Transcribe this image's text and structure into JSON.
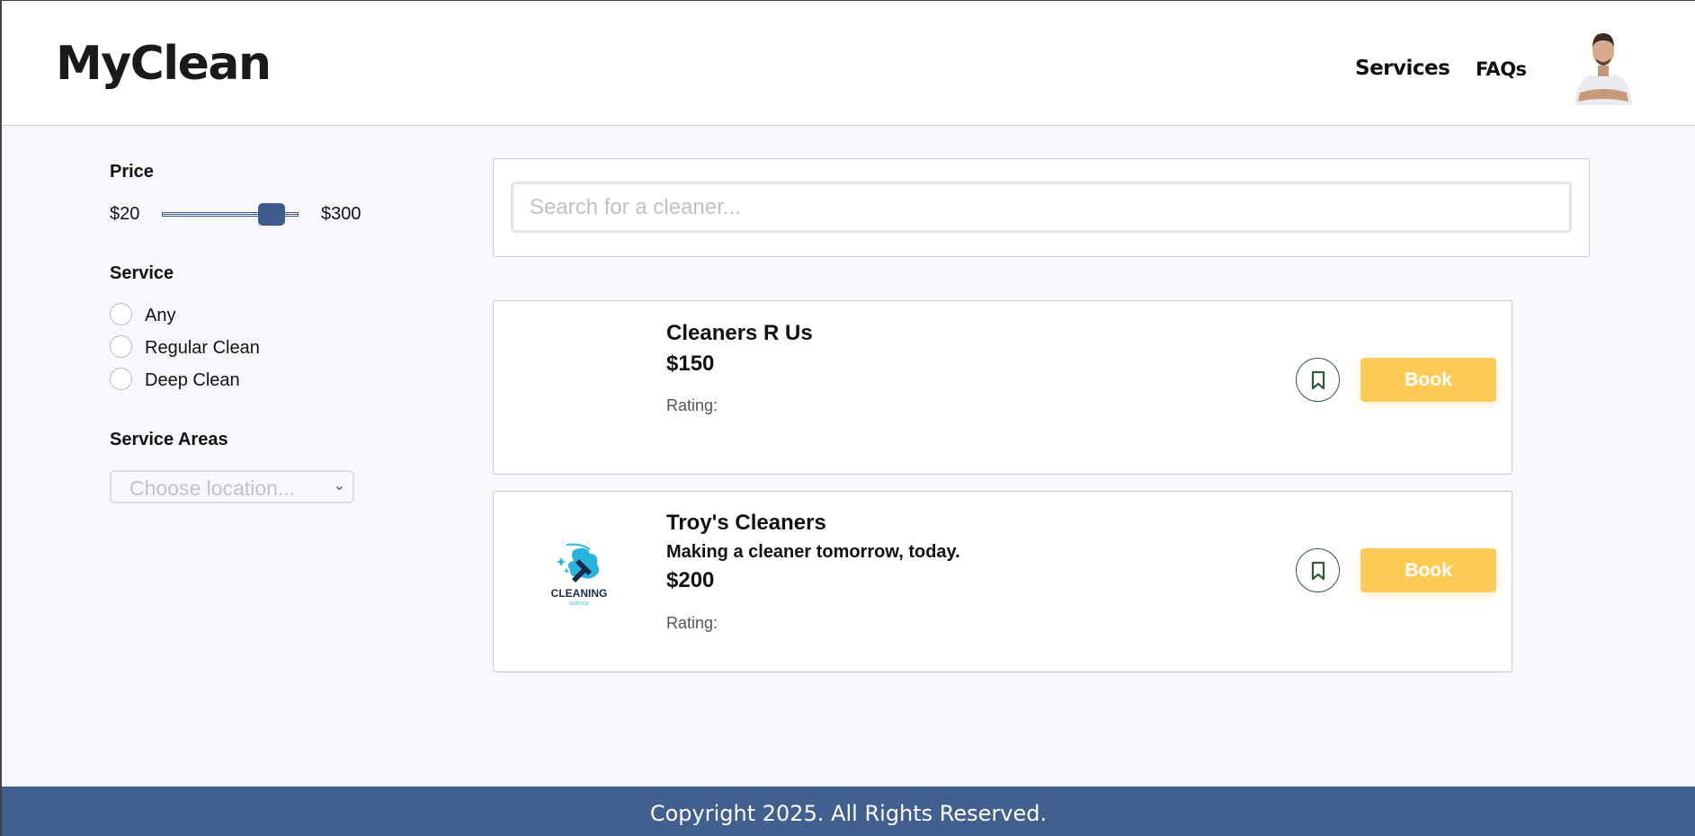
{
  "brand": {
    "name": "MyClean"
  },
  "nav": {
    "services": "Services",
    "faqs": "FAQs"
  },
  "filters": {
    "price": {
      "label": "Price",
      "min_label": "$20",
      "max_label": "$300",
      "min": 20,
      "max": 300,
      "value_fraction": 0.75
    },
    "service": {
      "label": "Service",
      "options": [
        "Any",
        "Regular Clean",
        "Deep Clean"
      ]
    },
    "areas": {
      "label": "Service Areas",
      "placeholder": "Choose location..."
    }
  },
  "search": {
    "placeholder": "Search for a cleaner..."
  },
  "cleaners": [
    {
      "name": "Cleaners R Us",
      "price": "$150",
      "rating_label": "Rating:",
      "book_label": "Book",
      "logo": "none"
    },
    {
      "name": "Troy's Cleaners",
      "tagline": "Making a cleaner tomorrow, today.",
      "price": "$200",
      "rating_label": "Rating:",
      "book_label": "Book",
      "logo": "cleaning-service-logo",
      "logo_text": "CLEANING",
      "logo_subtext": "SERVICE"
    }
  ],
  "footer": {
    "copyright": "Copyright 2025. All Rights Reserved."
  },
  "colors": {
    "accent": "#41608f",
    "book": "#fecb57",
    "bookmark_border": "#2f5a3a"
  }
}
